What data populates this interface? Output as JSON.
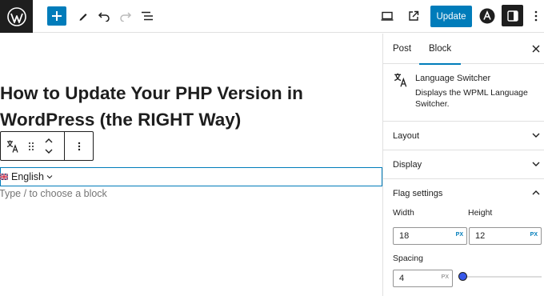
{
  "topbar": {
    "update_label": "Update",
    "icons": [
      "wordpress-logo",
      "plus",
      "pencil",
      "undo",
      "redo",
      "list-view",
      "desktop-preview",
      "external-view",
      "astra",
      "settings",
      "more-vertical"
    ]
  },
  "editor": {
    "title": "How to Update Your PHP Version in WordPress (the RIGHT Way)",
    "language_selector": "English",
    "placeholder": "Type / to choose a block"
  },
  "sidebar": {
    "tabs": [
      {
        "label": "Post"
      },
      {
        "label": "Block"
      }
    ],
    "active_tab": "Block",
    "block": {
      "name": "Language Switcher",
      "description": "Displays the WPML Language Switcher."
    },
    "panels": [
      {
        "title": "Layout"
      },
      {
        "title": "Display"
      },
      {
        "title": "Flag settings"
      }
    ],
    "flag_settings": {
      "width_label": "Width",
      "width_value": "18",
      "height_label": "Height",
      "height_value": "12",
      "unit": "PX",
      "unit_small": "PX",
      "spacing_label": "Spacing",
      "spacing_value": "4"
    }
  },
  "colors": {
    "accent": "#007cba",
    "dark": "#1e1e1e",
    "slider": "#3858e9"
  }
}
